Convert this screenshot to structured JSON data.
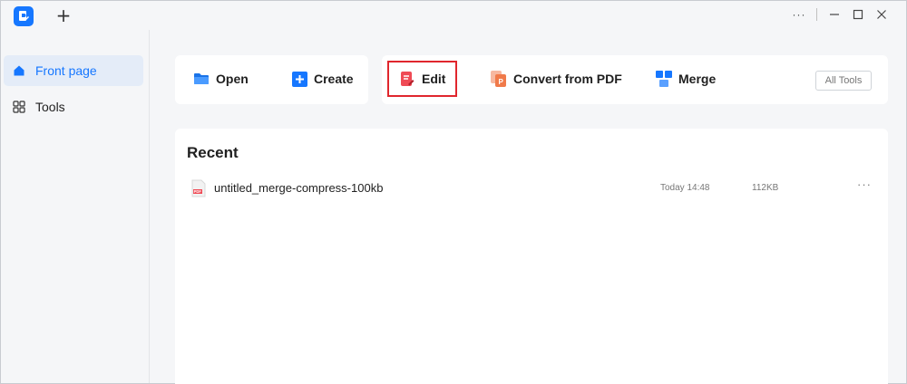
{
  "titlebar": {
    "new_tab_label": "+",
    "more_label": "···"
  },
  "sidebar": {
    "items": [
      {
        "label": "Front page",
        "icon": "home-icon",
        "active": true
      },
      {
        "label": "Tools",
        "icon": "grid-icon",
        "active": false
      }
    ]
  },
  "toolbar": {
    "open_label": "Open",
    "create_label": "Create",
    "edit_label": "Edit",
    "convert_label": "Convert from PDF",
    "merge_label": "Merge",
    "all_tools_label": "All Tools"
  },
  "recent": {
    "title": "Recent",
    "files": [
      {
        "name": "untitled_merge-compress-100kb",
        "time": "Today 14:48",
        "size": "112KB",
        "more": "···",
        "icon_label": "PDF"
      }
    ]
  },
  "colors": {
    "accent": "#1677ff",
    "highlight": "#e0262d",
    "edit_icon": "#ef4a55",
    "convert_icon": "#f07a4a"
  }
}
